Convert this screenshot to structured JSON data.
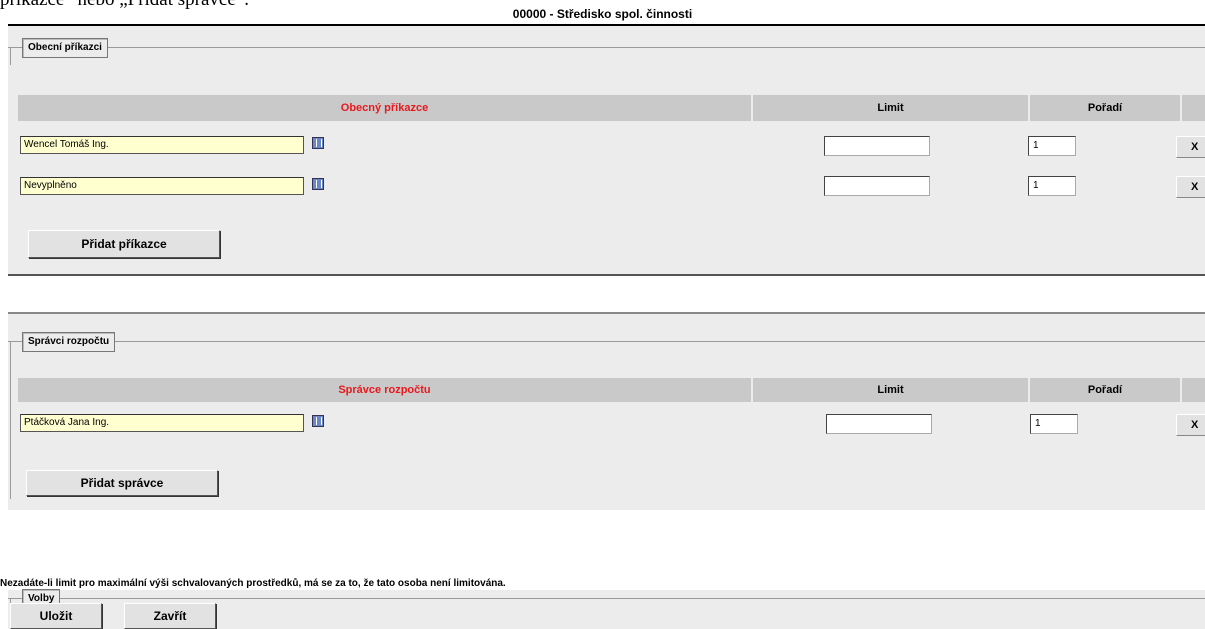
{
  "doc_snippet": "příkazce“ nebo „Přidat správce“.",
  "page_title": "00000 - Středisko spol. činnosti",
  "section_prikazci": {
    "legend": "Obecní příkazci",
    "headers": {
      "name": "Obecný příkazce",
      "limit": "Limit",
      "order": "Pořadí"
    },
    "rows": [
      {
        "name": "Wencel Tomáš Ing.",
        "limit": "",
        "order": "1",
        "remove_label": "X"
      },
      {
        "name": "Nevyplněno",
        "limit": "",
        "order": "1",
        "remove_label": "X"
      }
    ],
    "add_button": "Přidat příkazce"
  },
  "section_spravci": {
    "legend": "Správci rozpočtu",
    "headers": {
      "name": "Správce rozpočtu",
      "limit": "Limit",
      "order": "Pořadí"
    },
    "rows": [
      {
        "name": "Ptáčková Jana Ing.",
        "limit": "",
        "order": "1",
        "remove_label": "X"
      }
    ],
    "add_button": "Přidat správce"
  },
  "note": "Nezadáte-li limit pro maximální výši schvalovaných prostředků, má se za to, že tato osoba není limitována.",
  "section_volby": {
    "legend": "Volby",
    "save_button": "Uložit",
    "close_button": "Zavřít"
  },
  "colors": {
    "panel_bg": "#ececec",
    "header_bg": "#c9c9c9",
    "header_red": "#e8191e",
    "name_input_bg": "#ffffd0"
  },
  "icons": {
    "pick": "list-picker-icon"
  }
}
